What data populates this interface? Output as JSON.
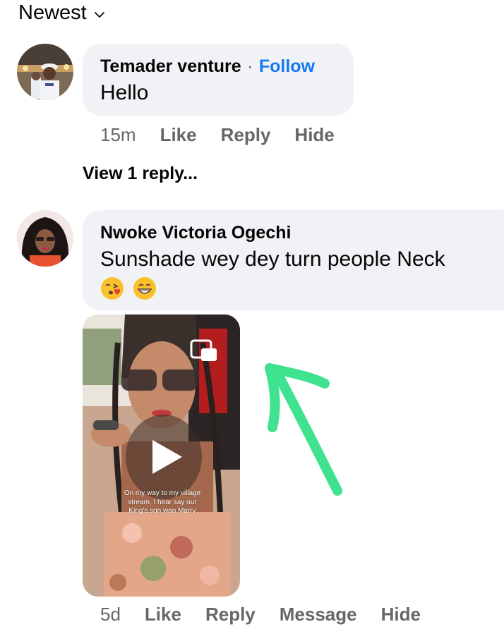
{
  "sort": {
    "label": "Newest",
    "icon": "chevron-down-icon"
  },
  "comments": [
    {
      "author": "Temader venture",
      "separator": "·",
      "follow_label": "Follow",
      "text": "Hello",
      "time": "15m",
      "actions": [
        "Like",
        "Reply",
        "Hide"
      ]
    },
    {
      "author": "Nwoke Victoria Ogechi",
      "text": "Sunshade wey dey turn people Neck",
      "emojis": [
        "kissing-face-with-heart-emoji",
        "grinning-face-emoji"
      ],
      "time": "5d",
      "actions": [
        "Like",
        "Reply",
        "Message",
        "Hide"
      ],
      "video": {
        "overlay_text": "On my way to my village stream, I hear say our King's son wan Marry"
      }
    }
  ],
  "view_replies": "View 1 reply...",
  "annotation": {
    "shape": "arrow-icon",
    "color": "#3ee28f"
  },
  "colors": {
    "link": "#1877f2",
    "bubble": "#f0f2f5",
    "secondary_text": "#65676b"
  }
}
